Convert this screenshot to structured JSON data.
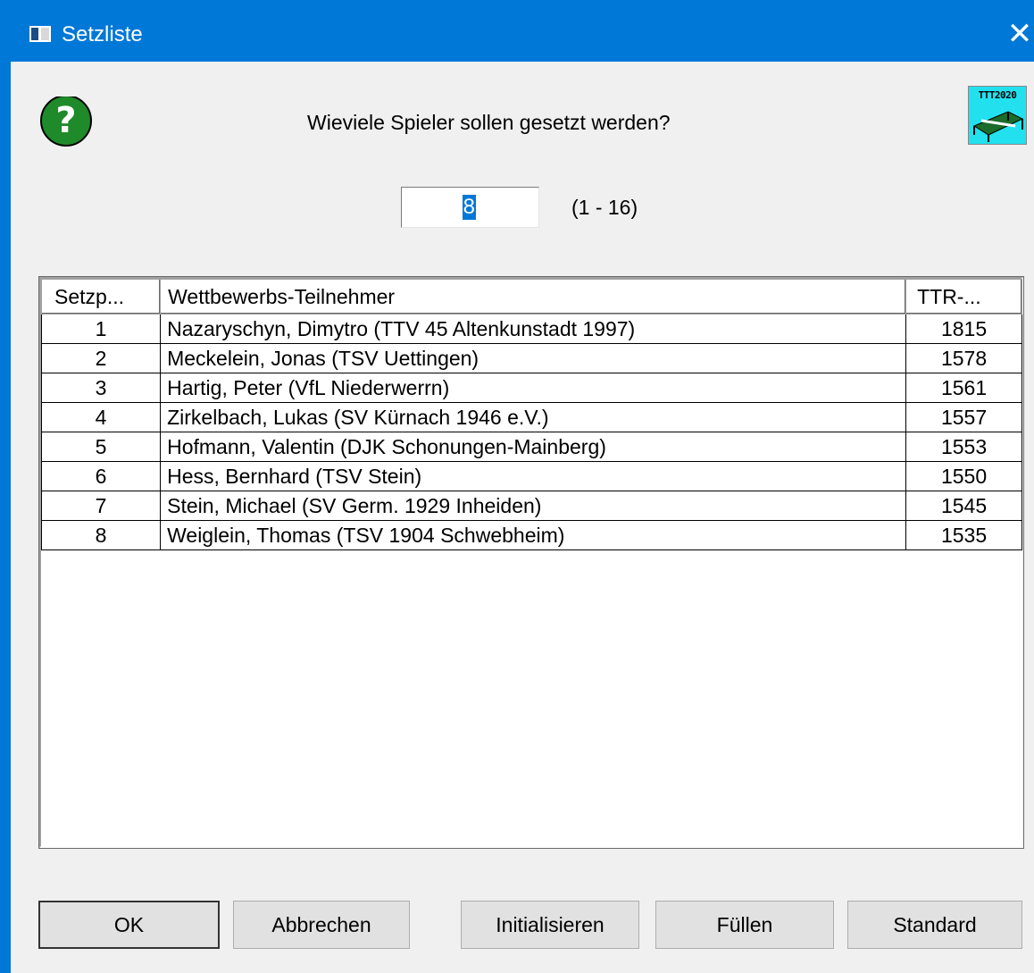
{
  "window": {
    "title": "Setzliste",
    "close_glyph": "✕",
    "app_icon": "window-icon"
  },
  "prompt": {
    "question": "Wieviele Spieler sollen gesetzt werden?",
    "count_value": "8",
    "range_label": "(1 - 16)",
    "help_icon": "question-mark-icon",
    "help_icon_color": "#1f8a2a",
    "logo_text": "TTT2020"
  },
  "table": {
    "headers": [
      "Setzp...",
      "Wettbewerbs-Teilnehmer",
      "TTR-..."
    ],
    "rows": [
      [
        "1",
        "Nazaryschyn, Dimytro (TTV 45 Altenkunstadt 1997)",
        "1815"
      ],
      [
        "2",
        "Meckelein, Jonas (TSV Uettingen)",
        "1578"
      ],
      [
        "3",
        "Hartig, Peter (VfL Niederwerrn)",
        "1561"
      ],
      [
        "4",
        "Zirkelbach, Lukas (SV Kürnach 1946 e.V.)",
        "1557"
      ],
      [
        "5",
        "Hofmann, Valentin (DJK Schonungen-Mainberg)",
        "1553"
      ],
      [
        "6",
        "Hess, Bernhard (TSV Stein)",
        "1550"
      ],
      [
        "7",
        "Stein, Michael (SV Germ. 1929 Inheiden)",
        "1545"
      ],
      [
        "8",
        "Weiglein, Thomas (TSV 1904 Schwebheim)",
        "1535"
      ]
    ]
  },
  "buttons": {
    "ok": "OK",
    "cancel": "Abbrechen",
    "initialize": "Initialisieren",
    "fill": "Füllen",
    "standard": "Standard"
  },
  "colors": {
    "titlebar": "#0078d7",
    "dialog_bg": "#f0f0f0",
    "selection": "#0078d7"
  }
}
